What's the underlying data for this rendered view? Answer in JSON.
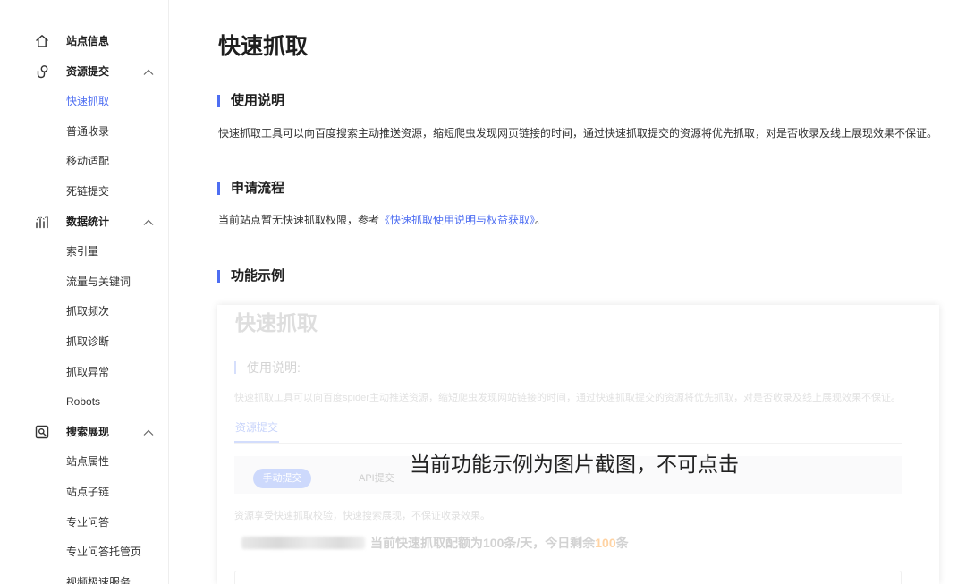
{
  "colors": {
    "accent": "#4e6ef2",
    "highlight": "#ff9c1a",
    "text": "#333333"
  },
  "sidebar": {
    "groups": [
      {
        "label": "站点信息",
        "icon": "home-icon",
        "items": []
      },
      {
        "label": "资源提交",
        "icon": "submit-icon",
        "expanded": true,
        "items": [
          {
            "label": "快速抓取",
            "active": true
          },
          {
            "label": "普通收录"
          },
          {
            "label": "移动适配"
          },
          {
            "label": "死链提交"
          }
        ]
      },
      {
        "label": "数据统计",
        "icon": "chart-icon",
        "expanded": true,
        "items": [
          {
            "label": "索引量"
          },
          {
            "label": "流量与关键词"
          },
          {
            "label": "抓取频次"
          },
          {
            "label": "抓取诊断"
          },
          {
            "label": "抓取异常"
          },
          {
            "label": "Robots"
          }
        ]
      },
      {
        "label": "搜索展现",
        "icon": "search-display-icon",
        "expanded": true,
        "items": [
          {
            "label": "站点属性"
          },
          {
            "label": "站点子链"
          },
          {
            "label": "专业问答"
          },
          {
            "label": "专业问答托管页"
          },
          {
            "label": "视频极速服务"
          }
        ]
      }
    ]
  },
  "main": {
    "title": "快速抓取",
    "usage": {
      "heading": "使用说明",
      "text": "快速抓取工具可以向百度搜索主动推送资源，缩短爬虫发现网页链接的时间，通过快速抓取提交的资源将优先抓取，对是否收录及线上展现效果不保证。"
    },
    "apply": {
      "heading": "申请流程",
      "text_prefix": "当前站点暂无快速抓取权限，参考",
      "link": "《快速抓取使用说明与权益获取》",
      "text_suffix": "。"
    },
    "demo": {
      "heading": "功能示例"
    }
  },
  "example": {
    "title": "快速抓取",
    "subheading": "使用说明:",
    "text": "快速抓取工具可以向百度spider主动推送资源，缩短爬虫发现网站链接的时间，通过快速抓取提交的资源将优先抓取，对是否收录及线上展现效果不保证。",
    "tab": "资源提交",
    "manual_button": "手动提交",
    "api_button": "API提交",
    "overlay": "当前功能示例为图片截图，不可点击",
    "notice": "资源享受快速抓取校验，快速搜索展现，不保证收录效果。",
    "quota_prefix": "当前快速抓取配额为100条/天，今日剩余",
    "quota_remaining": "100",
    "quota_suffix": "条"
  }
}
